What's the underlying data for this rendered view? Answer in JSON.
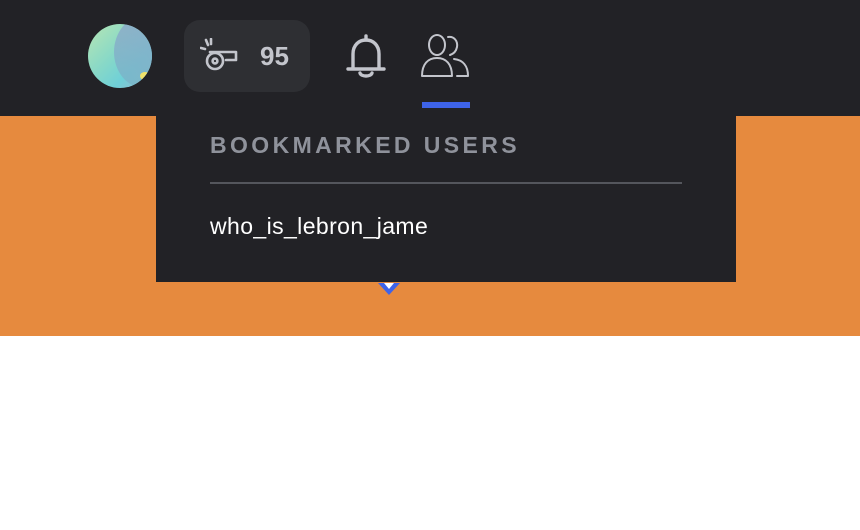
{
  "header": {
    "points": {
      "icon": "whistle-icon",
      "count": "95"
    },
    "notifications_icon": "bell-icon",
    "bookmarks_icon": "users-icon",
    "accent_color": "#3e63e8",
    "background_color": "#222226"
  },
  "dropdown": {
    "title": "BOOKMARKED USERS",
    "users": [
      "who_is_lebron_jame"
    ]
  },
  "page": {
    "banner_color": "#e68a3e"
  }
}
